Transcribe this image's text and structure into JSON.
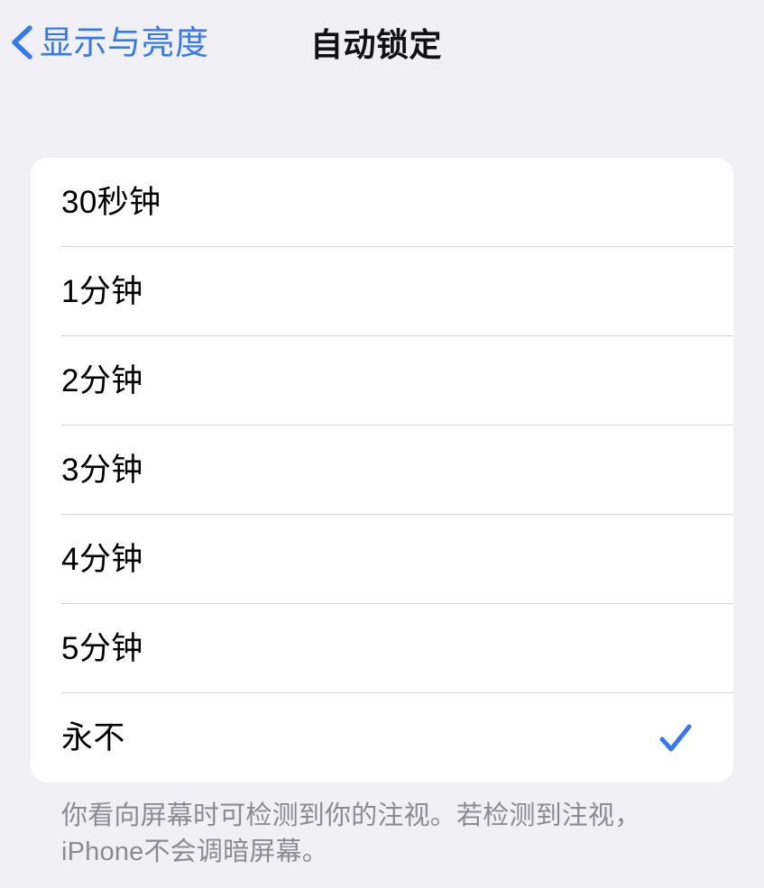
{
  "navbar": {
    "back_label": "显示与亮度",
    "title": "自动锁定",
    "back_icon": "chevron-left-icon",
    "accent_color": "#3478F6",
    "title_color": "#121214"
  },
  "list": {
    "selected_index": 6,
    "check_icon": "checkmark-icon",
    "check_color": "#3478F6",
    "rows": [
      {
        "label": "30秒钟",
        "checked": false
      },
      {
        "label": "1分钟",
        "checked": false
      },
      {
        "label": "2分钟",
        "checked": false
      },
      {
        "label": "3分钟",
        "checked": false
      },
      {
        "label": "4分钟",
        "checked": false
      },
      {
        "label": "5分钟",
        "checked": false
      },
      {
        "label": "永不",
        "checked": true
      }
    ]
  },
  "footer": {
    "note": "你看向屏幕时可检测到你的注视。若检测到注视，iPhone不会调暗屏幕。"
  },
  "theme": {
    "background": "#F1F0F5",
    "card_background": "#FFFFFF",
    "separator": "#D8D7DC",
    "footer_text": "#8B8B91"
  }
}
